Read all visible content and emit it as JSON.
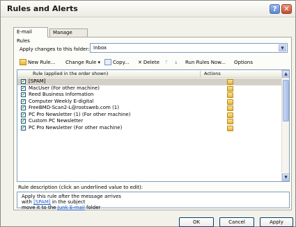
{
  "window": {
    "title": "Rules and Alerts"
  },
  "tabs": [
    {
      "label": "E-mail Rules"
    },
    {
      "label": "Manage Alerts"
    }
  ],
  "apply_changes": {
    "label": "Apply changes to this folder:",
    "value": "Inbox"
  },
  "toolbar": {
    "new_rule": "New Rule...",
    "change_rule": "Change Rule ▾",
    "copy": "Copy...",
    "delete": "Delete",
    "run_rules": "Run Rules Now...",
    "options": "Options"
  },
  "grid": {
    "col_rule": "Rule (applied in the order shown)",
    "col_actions": "Actions",
    "rows": [
      {
        "name": "[SPAM]",
        "checked": true,
        "selected": true
      },
      {
        "name": "MacUser  (For other machine)",
        "checked": true
      },
      {
        "name": "Reed Business Information",
        "checked": true
      },
      {
        "name": "Computer Weekly E-digital",
        "checked": true
      },
      {
        "name": "FreeBMD-Scan2-L@rootsweb.com (1)",
        "checked": true
      },
      {
        "name": "PC Pro Newsletter (1)  (For other machine)",
        "checked": true
      },
      {
        "name": "Custom PC Newsletter",
        "checked": true
      },
      {
        "name": "PC Pro Newsletter  (For other machine)",
        "checked": true
      }
    ]
  },
  "description": {
    "label": "Rule description (click an underlined value to edit):",
    "line1": "Apply this rule after the message arrives",
    "line2_pre": "with ",
    "line2_link": "[SPAM]",
    "line2_post": " in the subject",
    "line3_pre": "move it to the ",
    "line3_link": "Junk E-mail",
    "line3_post": " folder"
  },
  "buttons": {
    "ok": "OK",
    "cancel": "Cancel",
    "apply": "Apply"
  },
  "colors": {
    "link": "#1d5fcf",
    "selected_row": "#d4d0c8",
    "border": "#7f9db9"
  }
}
